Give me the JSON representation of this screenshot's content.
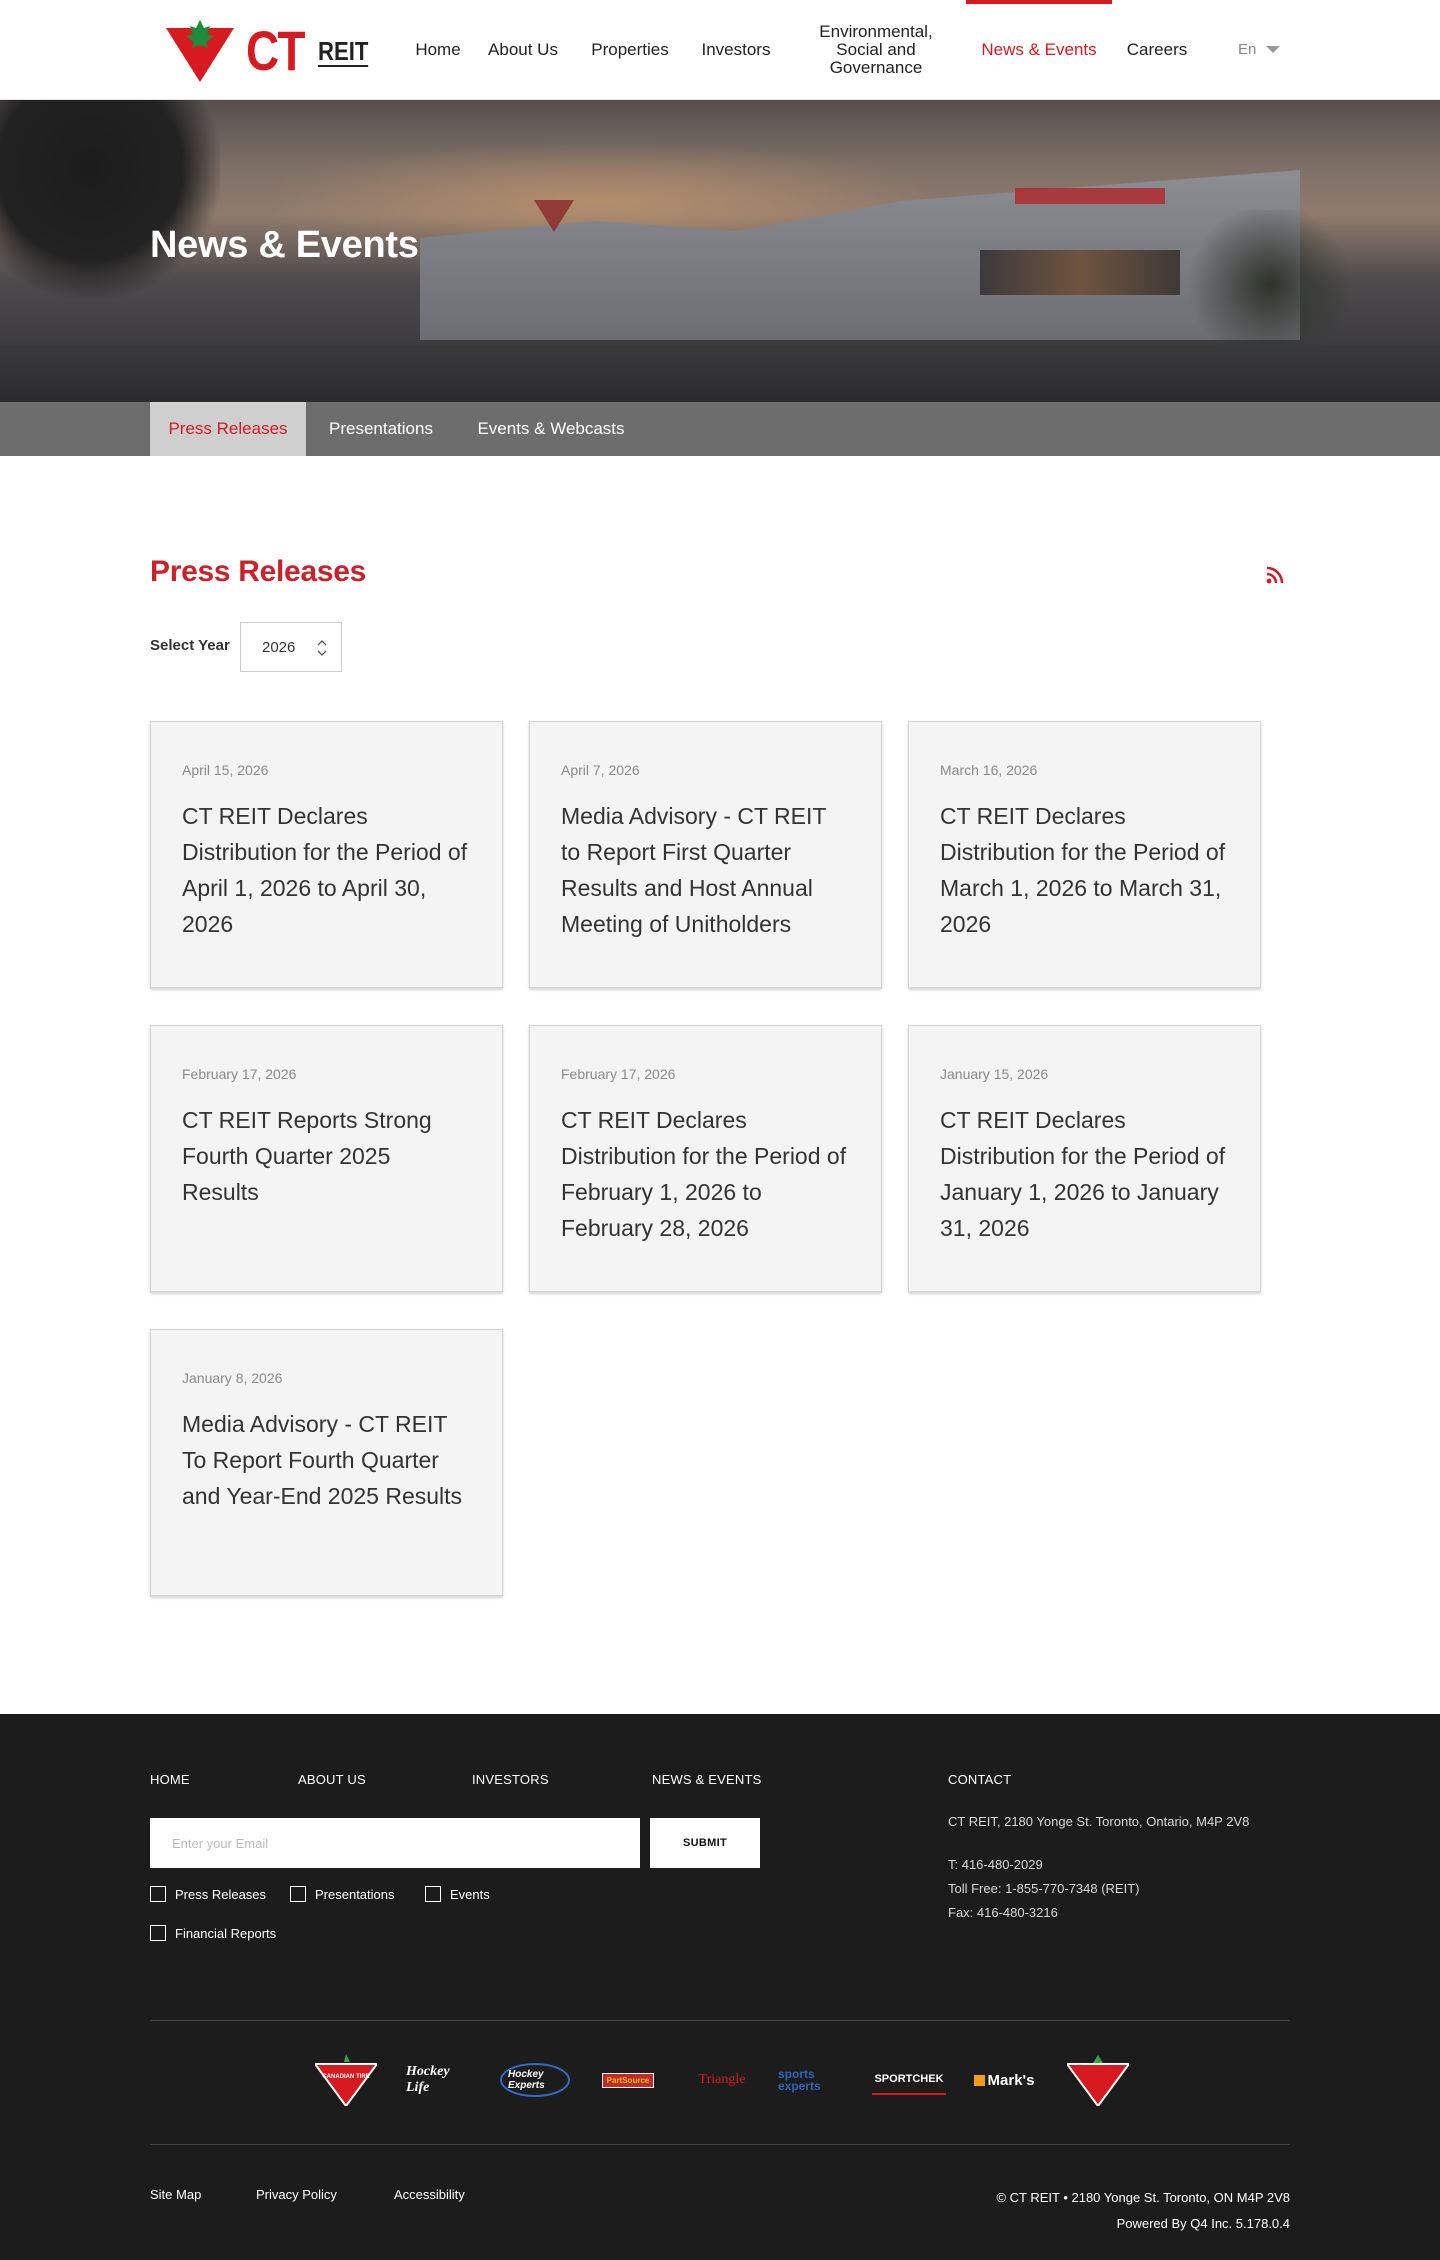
{
  "header": {
    "logo_text": "CT",
    "logo_subtext": "REIT",
    "nav": [
      {
        "label": "Home"
      },
      {
        "label": "About Us"
      },
      {
        "label": "Properties"
      },
      {
        "label": "Investors"
      },
      {
        "label": "Environmental, Social and Governance"
      },
      {
        "label": "News & Events",
        "active": true
      },
      {
        "label": "Careers"
      }
    ],
    "language": "En"
  },
  "hero": {
    "title": "News & Events"
  },
  "tabs": [
    {
      "label": "Press Releases",
      "active": true
    },
    {
      "label": "Presentations"
    },
    {
      "label": "Events & Webcasts"
    }
  ],
  "press": {
    "title": "Press Releases",
    "rss_icon": "rss-icon",
    "select_label": "Select Year",
    "selected_year": "2026",
    "items": [
      {
        "date": "April 15, 2026",
        "title": "CT REIT Declares Distribution for the Period of April 1, 2026 to April 30, 2026"
      },
      {
        "date": "April 7, 2026",
        "title": "Media Advisory - CT REIT to Report First Quarter Results and Host Annual Meeting of Unitholders"
      },
      {
        "date": "March 16, 2026",
        "title": "CT REIT Declares Distribution for the Period of March 1, 2026 to March 31, 2026"
      },
      {
        "date": "February 17, 2026",
        "title": "CT REIT Reports Strong Fourth Quarter 2025 Results"
      },
      {
        "date": "February 17, 2026",
        "title": "CT REIT Declares Distribution for the Period of February 1, 2026 to February 28, 2026"
      },
      {
        "date": "January 15, 2026",
        "title": "CT REIT Declares Distribution for the Period of January 1, 2026 to January 31, 2026"
      },
      {
        "date": "January 8, 2026",
        "title": "Media Advisory - CT REIT To Report Fourth Quarter and Year-End 2025 Results"
      }
    ]
  },
  "footer": {
    "links": [
      "HOME",
      "ABOUT US",
      "INVESTORS",
      "NEWS & EVENTS"
    ],
    "email_placeholder": "Enter your Email",
    "submit_label": "SUBMIT",
    "checkboxes": [
      "Press Releases",
      "Presentations",
      "Events",
      "Financial Reports"
    ],
    "contact": {
      "heading": "CONTACT",
      "address": "CT REIT, 2180 Yonge St. Toronto, Ontario, M4P 2V8",
      "phone": "T: 416-480-2029",
      "toll_free": "Toll Free: 1-855-770-7348 (REIT)",
      "fax": "Fax: 416-480-3216"
    },
    "brands": [
      {
        "name": "canadian-tire",
        "label": "CANADIAN TIRE"
      },
      {
        "name": "hockey-life",
        "label": "Hockey Life"
      },
      {
        "name": "hockey-experts",
        "label": "Hockey Experts"
      },
      {
        "name": "partsource",
        "label": "PartSource"
      },
      {
        "name": "triangle",
        "label": "Triangle"
      },
      {
        "name": "sports-experts",
        "label": "sports experts"
      },
      {
        "name": "sportchek",
        "label": "SPORTCHEK"
      },
      {
        "name": "marks",
        "label": "Mark's"
      },
      {
        "name": "canadian-tire-logo",
        "label": ""
      }
    ],
    "bottom_links": [
      "Site Map",
      "Privacy Policy",
      "Accessibility"
    ],
    "copyright": "© CT REIT • 2180 Yonge St. Toronto, ON M4P 2V8",
    "powered_by": "Powered By Q4 Inc. 5.178.0.4"
  },
  "colors": {
    "brand_red": "#d71920",
    "footer_bg": "#1c1c1d",
    "tab_bar_bg": "#6d6d6d"
  }
}
